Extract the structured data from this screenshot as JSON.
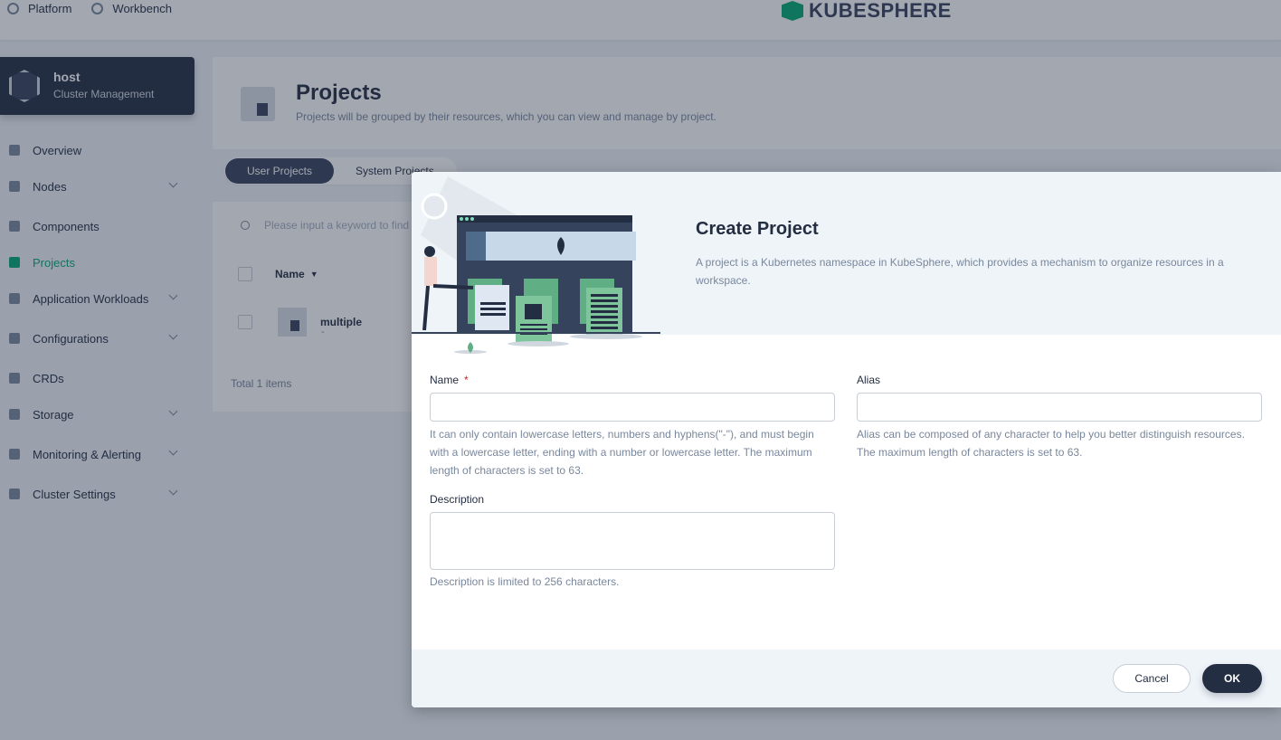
{
  "topbar": {
    "nav": [
      {
        "label": "Platform",
        "icon": "gear-icon"
      },
      {
        "label": "Workbench",
        "icon": "workbench-icon"
      }
    ],
    "logo_text": "KUBESPHERE"
  },
  "sidebar": {
    "cluster": {
      "name": "host",
      "subtitle": "Cluster Management"
    },
    "items": [
      {
        "label": "Overview",
        "icon": "overview-icon",
        "expandable": false
      },
      {
        "label": "Nodes",
        "icon": "nodes-icon",
        "expandable": true
      },
      {
        "label": "Components",
        "icon": "components-icon",
        "expandable": false
      },
      {
        "label": "Projects",
        "icon": "projects-icon",
        "expandable": false,
        "active": true
      },
      {
        "label": "Application Workloads",
        "icon": "workloads-icon",
        "expandable": true
      },
      {
        "label": "Configurations",
        "icon": "configurations-icon",
        "expandable": true
      },
      {
        "label": "CRDs",
        "icon": "crds-icon",
        "expandable": false
      },
      {
        "label": "Storage",
        "icon": "storage-icon",
        "expandable": true
      },
      {
        "label": "Monitoring & Alerting",
        "icon": "monitoring-icon",
        "expandable": true
      },
      {
        "label": "Cluster Settings",
        "icon": "cluster-settings-icon",
        "expandable": true
      }
    ]
  },
  "page": {
    "title": "Projects",
    "description": "Projects will be grouped by their resources, which you can view and manage by project.",
    "tabs": [
      "User Projects",
      "System Projects"
    ],
    "search_placeholder": "Please input a keyword to find",
    "column_name": "Name",
    "rows": [
      {
        "name": "multiple",
        "alias": "-"
      }
    ],
    "total": "Total 1 items"
  },
  "modal": {
    "title": "Create Project",
    "description": "A project is a Kubernetes namespace in KubeSphere, which provides a mechanism to organize resources in a workspace.",
    "name": {
      "label": "Name",
      "required_mark": "*",
      "value": "",
      "hint": "It can only contain lowercase letters, numbers and hyphens(\"-\"), and must begin with a lowercase letter, ending with a number or lowercase letter. The maximum length of characters is set to 63."
    },
    "alias": {
      "label": "Alias",
      "value": "",
      "hint": "Alias can be composed of any character to help you better distinguish resources. The maximum length of characters is set to 63."
    },
    "description_field": {
      "label": "Description",
      "value": "",
      "hint": "Description is limited to 256 characters."
    },
    "cancel_label": "Cancel",
    "ok_label": "OK"
  },
  "colors": {
    "primary_dark": "#242e42",
    "accent_green": "#00aa72",
    "required_red": "#ca2621"
  }
}
